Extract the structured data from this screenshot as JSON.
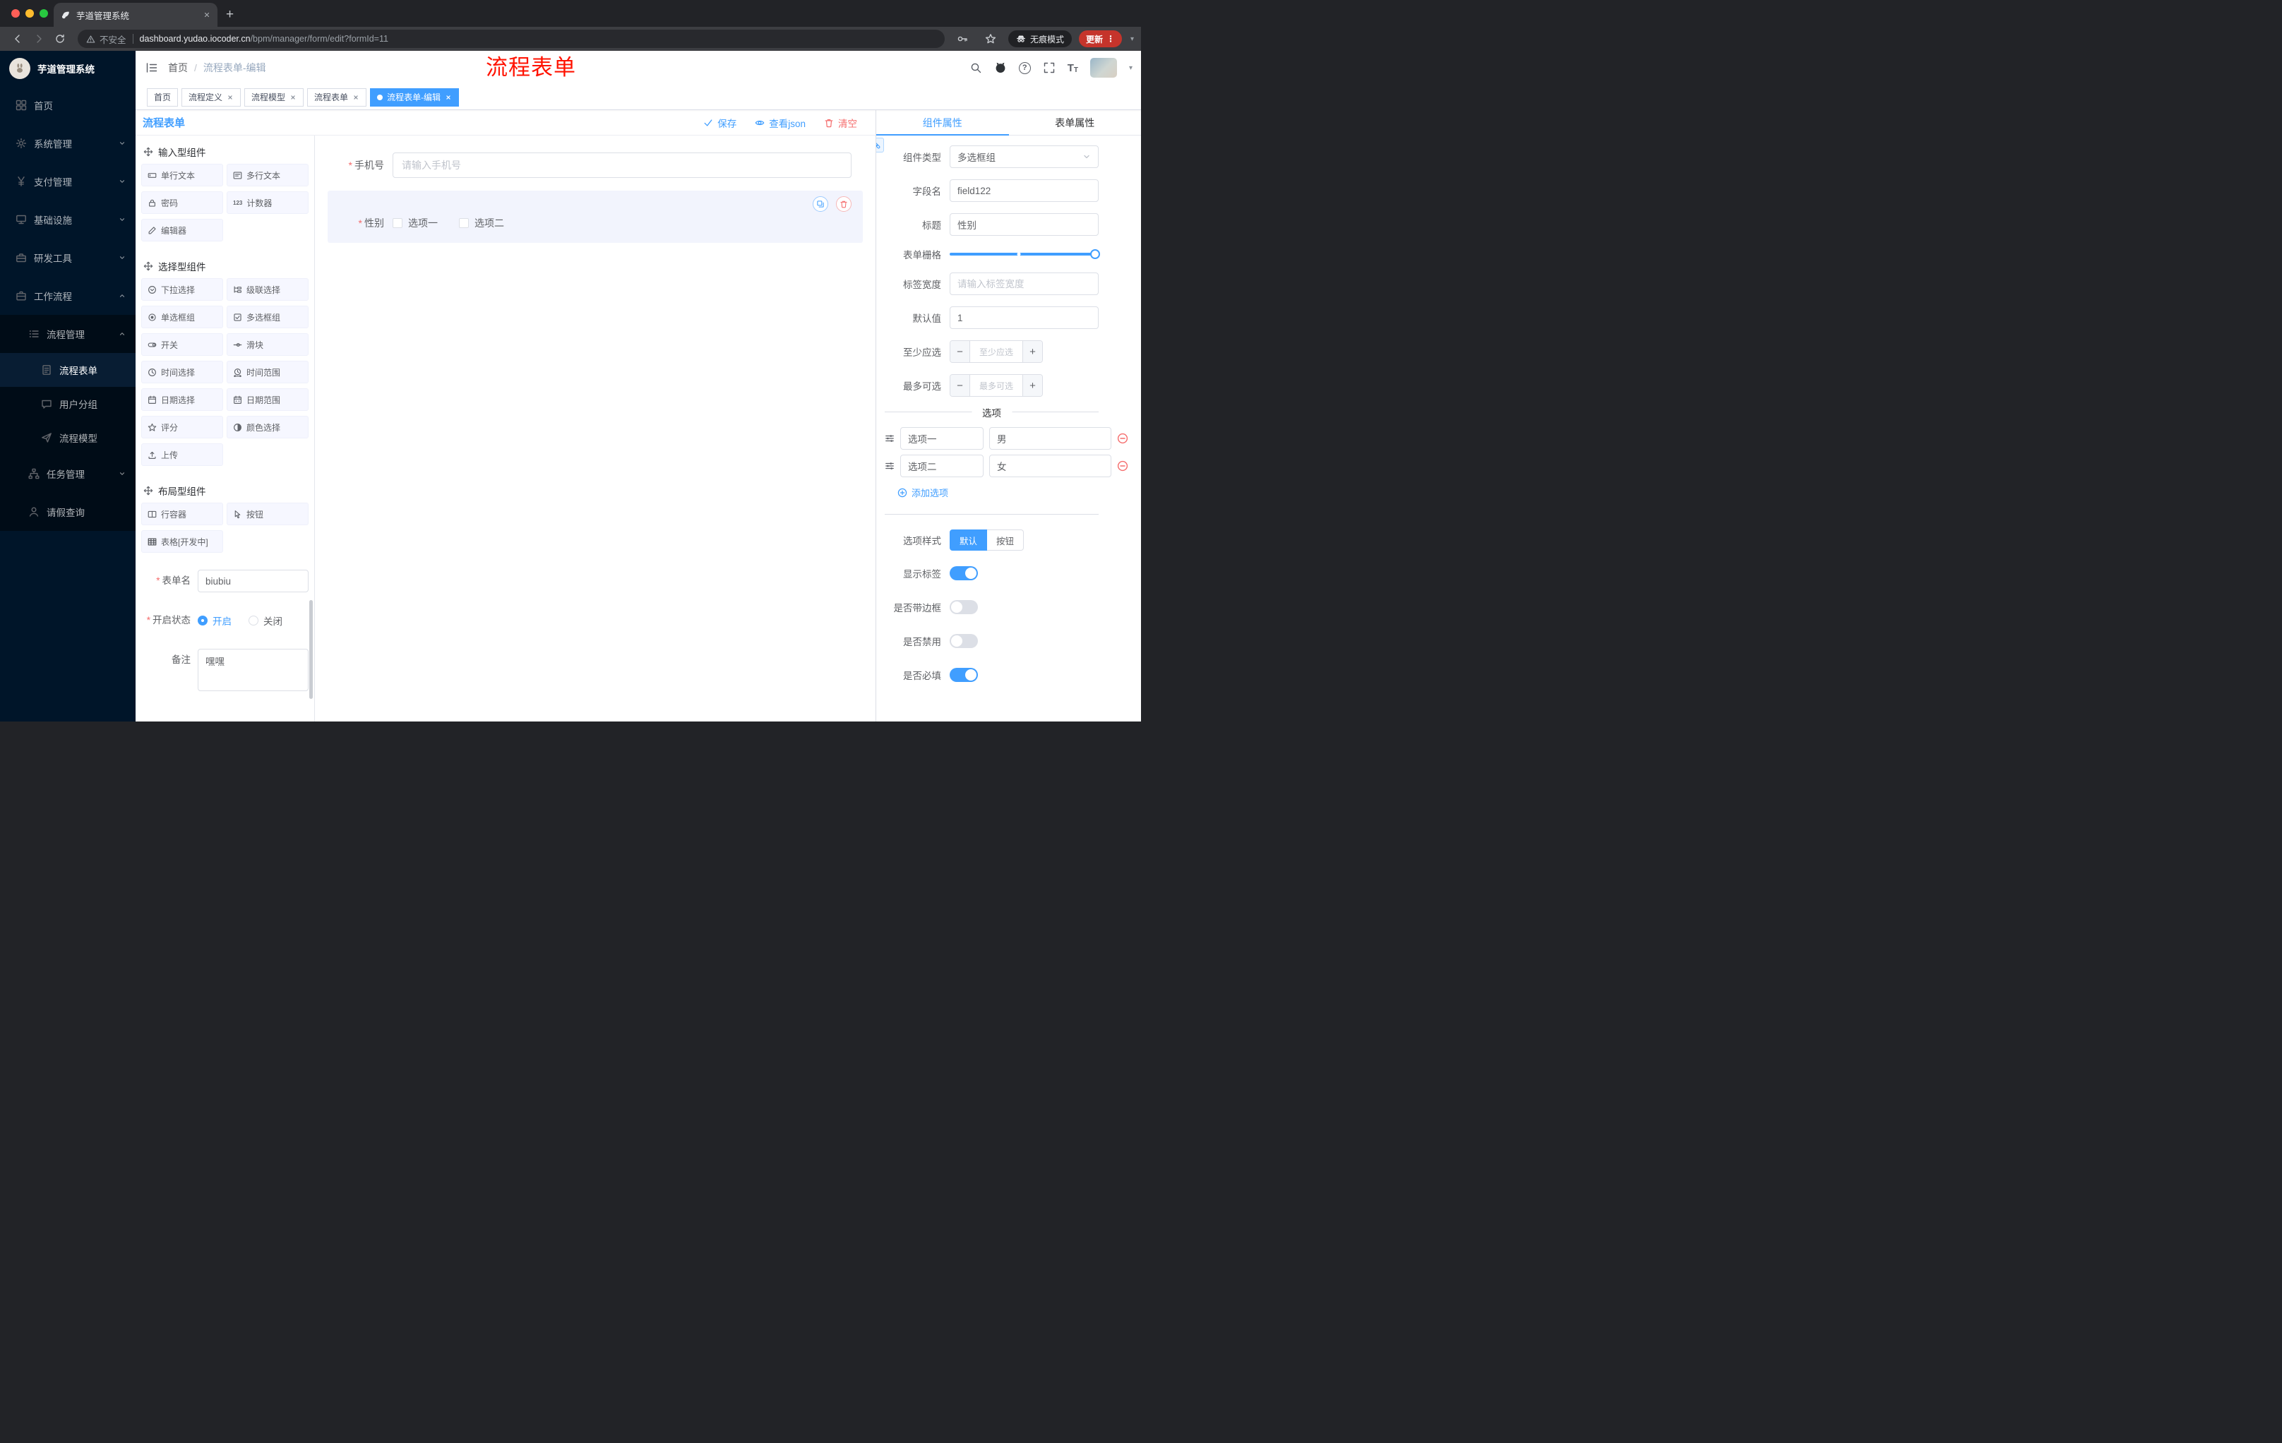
{
  "colors": {
    "accent": "#409EFF",
    "danger": "#F56C6C",
    "annotation_red": "#FF1200",
    "sidebar_bg": "#001529",
    "active_tab_bg": "#409EFF",
    "update_button_bg": "#C5342B"
  },
  "glyphs": {
    "slash": "/",
    "star": "*",
    "dots": "⋮",
    "caret": "▾",
    "new_tab": "+",
    "minus": "−",
    "plus": "+",
    "counter": "123",
    "help": "?",
    "tt_big": "T",
    "tt_small": "T"
  },
  "browser": {
    "tab_title": "芋道管理系统",
    "security_label": "不安全",
    "url_host": "dashboard.yudao.iocoder.cn",
    "url_path": "/bpm/manager/form/edit?formId=11",
    "incognito_label": "无痕模式",
    "update_label": "更新"
  },
  "sidebar": {
    "logo_title": "芋道管理系统",
    "items": [
      {
        "label": "首页",
        "icon": "home"
      },
      {
        "label": "系统管理",
        "icon": "gear"
      },
      {
        "label": "支付管理",
        "icon": "payment"
      },
      {
        "label": "基础设施",
        "icon": "infrastructure"
      },
      {
        "label": "研发工具",
        "icon": "dev-tools"
      },
      {
        "label": "工作流程",
        "icon": "workflow",
        "expanded": true
      },
      {
        "label": "流程管理",
        "icon": "process-management",
        "expanded": true
      },
      {
        "label": "流程表单",
        "icon": "process-form",
        "active": true
      },
      {
        "label": "用户分组",
        "icon": "user-group"
      },
      {
        "label": "流程模型",
        "icon": "process-model"
      },
      {
        "label": "任务管理",
        "icon": "task-management"
      },
      {
        "label": "请假查询",
        "icon": "leave-query"
      }
    ]
  },
  "header": {
    "breadcrumb_home": "首页",
    "breadcrumb_current": "流程表单-编辑",
    "annotation": "流程表单"
  },
  "tags": [
    {
      "label": "首页",
      "closable": false,
      "active": false
    },
    {
      "label": "流程定义",
      "closable": true,
      "active": false
    },
    {
      "label": "流程模型",
      "closable": true,
      "active": false
    },
    {
      "label": "流程表单",
      "closable": true,
      "active": false
    },
    {
      "label": "流程表单-编辑",
      "closable": true,
      "active": true
    }
  ],
  "designer": {
    "panel_title": "流程表单",
    "actions": {
      "save": "保存",
      "view_json": "查看json",
      "clear": "清空"
    },
    "groups": {
      "input": "输入型组件",
      "select": "选择型组件",
      "layout": "布局型组件"
    },
    "components": {
      "input": [
        "单行文本",
        "多行文本",
        "密码",
        "计数器",
        "编辑器"
      ],
      "select": [
        "下拉选择",
        "级联选择",
        "单选框组",
        "多选框组",
        "开关",
        "滑块",
        "时间选择",
        "时间范围",
        "日期选择",
        "日期范围",
        "评分",
        "颜色选择",
        "上传"
      ],
      "layout": [
        "行容器",
        "按钮",
        "表格[开发中]"
      ]
    },
    "form_config": {
      "form_name_label": "表单名",
      "form_name_value": "biubiu",
      "status_label": "开启状态",
      "status_on": "开启",
      "status_off": "关闭",
      "status_selected": "开启",
      "remark_label": "备注",
      "remark_value": "嘿嘿"
    },
    "canvas": {
      "phone_label": "手机号",
      "phone_placeholder": "请输入手机号",
      "gender_label": "性别",
      "gender_option1": "选项一",
      "gender_option2": "选项二"
    },
    "props": {
      "tab_component": "组件属性",
      "tab_form": "表单属性",
      "component_type_label": "组件类型",
      "component_type_value": "多选框组",
      "field_name_label": "字段名",
      "field_name_value": "field122",
      "title_label": "标题",
      "title_value": "性别",
      "grid_label": "表单栅格",
      "label_width_label": "标签宽度",
      "label_width_placeholder": "请输入标签宽度",
      "default_label": "默认值",
      "default_value": "1",
      "min_label": "至少应选",
      "min_placeholder": "至少应选",
      "max_label": "最多可选",
      "max_placeholder": "最多可选",
      "options_title": "选项",
      "options": [
        {
          "name": "选项一",
          "value": "男"
        },
        {
          "name": "选项二",
          "value": "女"
        }
      ],
      "add_option": "添加选项",
      "style_label": "选项样式",
      "style_options": [
        "默认",
        "按钮"
      ],
      "style_selected": "默认",
      "toggles": [
        {
          "label": "显示标签",
          "on": true
        },
        {
          "label": "是否带边框",
          "on": false
        },
        {
          "label": "是否禁用",
          "on": false
        },
        {
          "label": "是否必填",
          "on": true
        }
      ]
    }
  }
}
